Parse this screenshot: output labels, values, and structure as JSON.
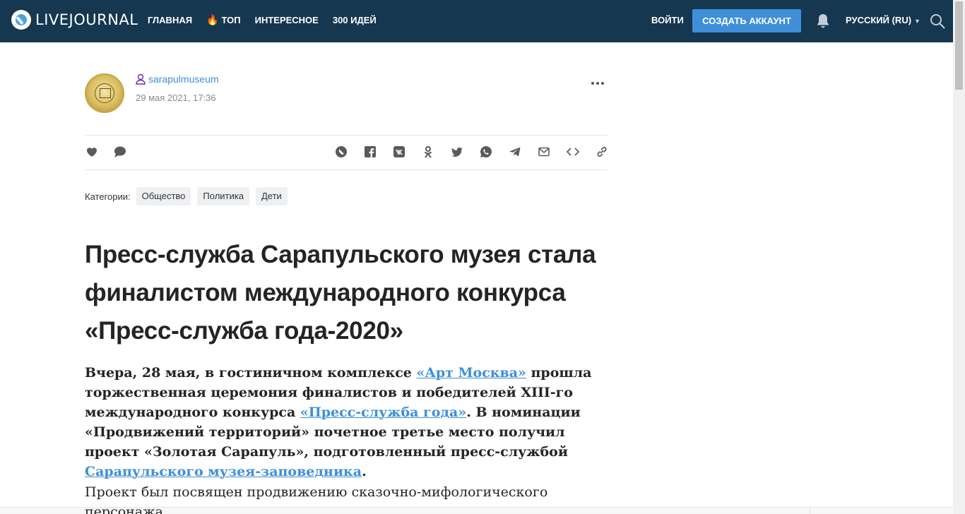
{
  "header": {
    "logo_text": "LIVEJOURNAL",
    "nav": [
      "ГЛАВНАЯ",
      "ТОП",
      "ИНТЕРЕСНОЕ",
      "300 ИДЕЙ"
    ],
    "login": "ВОЙТИ",
    "create_account": "СОЗДАТЬ АККАУНТ",
    "language": "РУССКИЙ (RU)",
    "colors": {
      "bar": "#15374f",
      "accent": "#3e8fd8"
    }
  },
  "post": {
    "author": "sarapulmuseum",
    "date": "29 мая 2021, 17:36",
    "categories_label": "Категории:",
    "categories": [
      "Общество",
      "Политика",
      "Дети"
    ],
    "title": "Пресс-служба Сарапульского музея стала финалистом международного конкурса «Пресс-служба года-2020»",
    "lead": {
      "t1": "Вчера, 28 мая, в гостиничном комплексе ",
      "l1": "«Арт Москва»",
      "t2": " прошла торжественная церемония финалистов и победителей XIII-го международного конкурса ",
      "l2": "«Пресс-служба года»",
      "t3": ". В номинации «Продвижений территорий» почетное третье место получил проект «Золотая Сарапуль», подготовленный пресс-службой ",
      "l3": "Сарапульского музея-заповедника",
      "t4": "."
    },
    "body_text": "Проект был посвящен продвижению сказочно-мифологического персонажа"
  },
  "icons": {
    "actions_left": [
      "heart-icon",
      "comment-icon"
    ],
    "share": [
      "livejournal-share-icon",
      "facebook-icon",
      "vk-icon",
      "odnoklassniki-icon",
      "twitter-icon",
      "whatsapp-icon",
      "telegram-icon",
      "email-icon",
      "embed-code-icon",
      "copy-link-icon"
    ]
  }
}
